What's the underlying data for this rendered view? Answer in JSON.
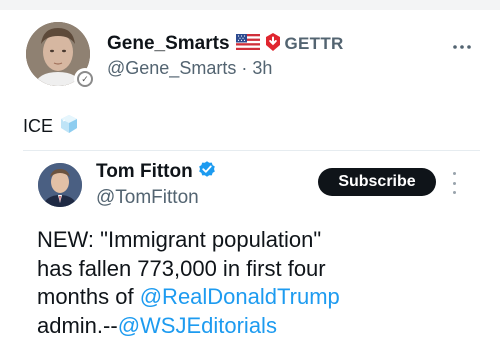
{
  "post": {
    "author": {
      "display_name": "Gene_Smarts",
      "platform_label": "GETTR",
      "handle": "@Gene_Smarts",
      "separator": "·",
      "time": "3h"
    },
    "more_icon": "ellipsis-icon",
    "text": "ICE",
    "emoji": "ice-cube-icon"
  },
  "quote": {
    "author": {
      "display_name": "Tom Fitton",
      "handle": "@TomFitton"
    },
    "subscribe_label": "Subscribe",
    "body": {
      "line1": "NEW: \"Immigrant population\"",
      "line2": "has fallen 773,000 in first four",
      "line3_prefix": "months of ",
      "line3_mention": "@RealDonaldTrump",
      "line4_prefix": "admin.--",
      "line4_mention": "@WSJEditorials"
    }
  },
  "colors": {
    "text": "#0f1419",
    "secondary": "#536471",
    "mention": "#1d9bf0",
    "verified_blue": "#1d9bf0",
    "gettr_red": "#e0262f",
    "button_bg": "#0f1419"
  }
}
